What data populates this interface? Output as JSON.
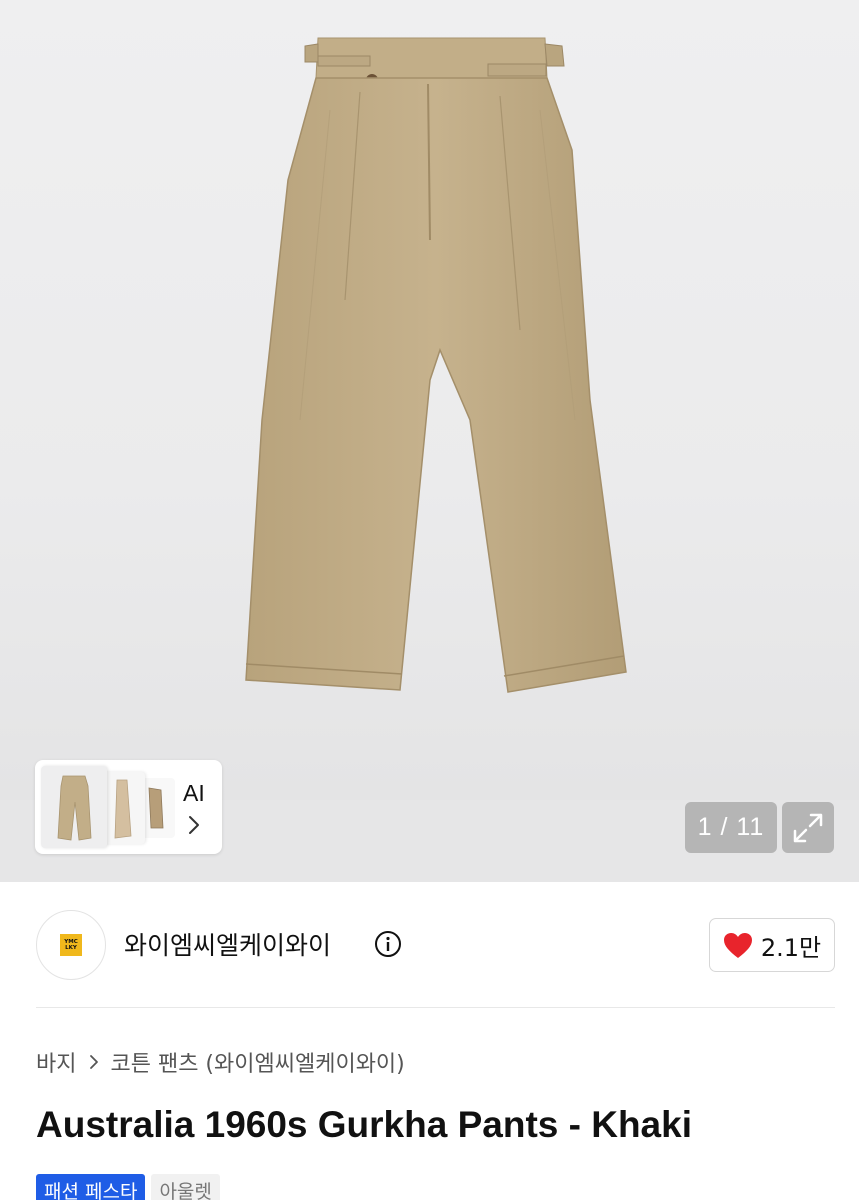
{
  "gallery": {
    "counter_text": "1 / 11",
    "thumbnails": [
      {
        "icon": "pants-front-thumbnail"
      },
      {
        "icon": "pants-side-thumbnail"
      },
      {
        "icon": "pants-detail-thumbnail"
      }
    ],
    "ai_label": "AI",
    "expand_icon": "expand-icon"
  },
  "shop": {
    "name": "와이엠씨엘케이와이",
    "logo_text_line1": "YMC",
    "logo_text_line2": "LKY",
    "likes": "2.1만",
    "like_icon": "heart-icon"
  },
  "breadcrumb": {
    "category": "바지",
    "subcategory": "코튼 팬츠 (와이엠씨엘케이와이)"
  },
  "product": {
    "title": "Australia 1960s Gurkha Pants - Khaki",
    "tags": [
      "패션 페스타",
      "아울렛"
    ]
  },
  "colors": {
    "accent_blue": "#1f5de6",
    "heart_red": "#e8242c",
    "khaki": "#c2ae88"
  }
}
